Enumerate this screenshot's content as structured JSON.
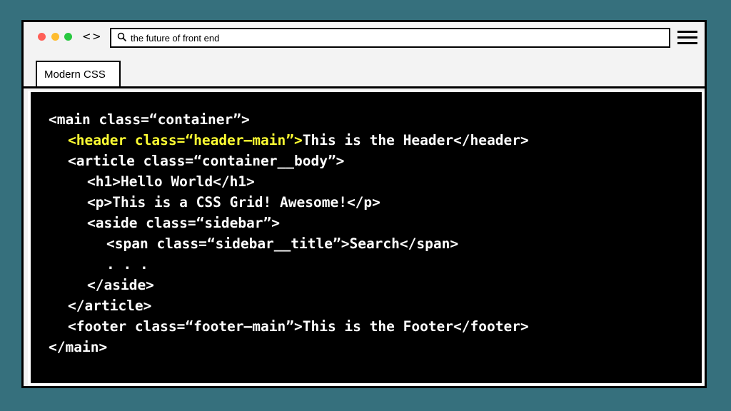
{
  "browser": {
    "search_query": "the future of front end",
    "back_glyph": "<",
    "forward_glyph": ">",
    "tab_label": "Modern CSS",
    "traffic_lights": [
      "#ff5f57",
      "#febc2e",
      "#28c840"
    ]
  },
  "code": {
    "highlight_color": "#ffff33",
    "text_color": "#ffffff",
    "lines": [
      {
        "indent": 0,
        "text": "<main class=“container”>",
        "highlight": ""
      },
      {
        "indent": 1,
        "text": "This is the Header</header>",
        "highlight": "<header class=“header—main”>"
      },
      {
        "indent": 1,
        "text": "<article class=“container__body”>",
        "highlight": ""
      },
      {
        "indent": 2,
        "text": "<h1>Hello World</h1>",
        "highlight": ""
      },
      {
        "indent": 2,
        "text": "<p>This is a CSS Grid! Awesome!</p>",
        "highlight": ""
      },
      {
        "indent": 2,
        "text": "<aside class=“sidebar”>",
        "highlight": ""
      },
      {
        "indent": 3,
        "text": "<span class=“sidebar__title”>Search</span>",
        "highlight": ""
      },
      {
        "indent": 3,
        "text": ". . .",
        "highlight": ""
      },
      {
        "indent": 2,
        "text": "</aside>",
        "highlight": ""
      },
      {
        "indent": 1,
        "text": "</article>",
        "highlight": ""
      },
      {
        "indent": 1,
        "text": "<footer class=“footer—main”>This is the Footer</footer>",
        "highlight": ""
      },
      {
        "indent": 0,
        "text": "</main>",
        "highlight": ""
      }
    ]
  }
}
